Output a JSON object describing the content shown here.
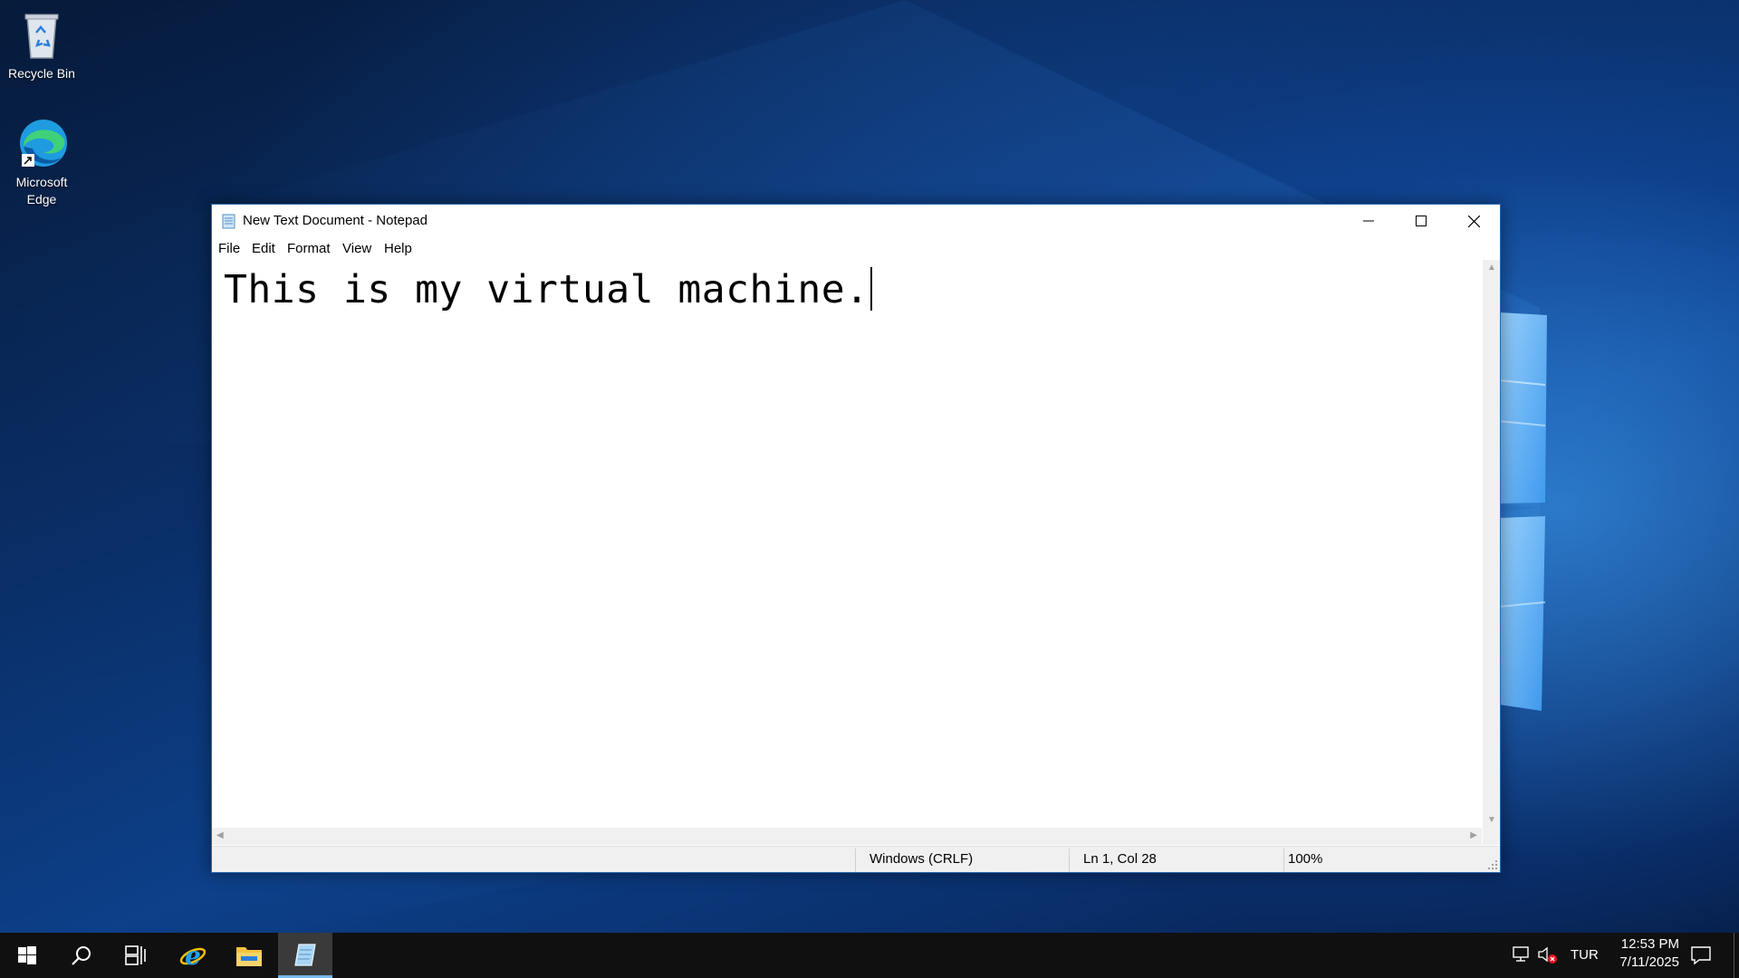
{
  "desktop": {
    "icons": [
      {
        "label": "Recycle Bin",
        "icon": "recycle-bin-icon"
      },
      {
        "label": "Microsoft Edge",
        "label_lines": [
          "Microsoft",
          "Edge"
        ],
        "icon": "edge-icon"
      }
    ]
  },
  "window": {
    "title": "New Text Document - Notepad",
    "app_icon": "notepad-icon",
    "controls": {
      "minimize": "minimize-icon",
      "maximize": "maximize-icon",
      "close": "close-icon"
    },
    "menu": [
      "File",
      "Edit",
      "Format",
      "View",
      "Help"
    ],
    "content": "This is my virtual machine.",
    "status": {
      "line_ending": "Windows (CRLF)",
      "position": "Ln 1, Col 28",
      "zoom": "100%"
    }
  },
  "taskbar": {
    "items": [
      "start-icon",
      "search-icon",
      "task-view-icon",
      "internet-explorer-icon",
      "file-explorer-icon",
      "notepad-icon"
    ],
    "active_item": "notepad-icon",
    "tray": {
      "language": "TUR",
      "time": "12:53 PM",
      "date": "7/11/2025",
      "icons": [
        "network-icon",
        "volume-muted-icon",
        "action-center-icon"
      ]
    }
  },
  "colors": {
    "accent": "#76b9ed",
    "taskbar": "#101010",
    "window_border": "#2b6cb0"
  }
}
